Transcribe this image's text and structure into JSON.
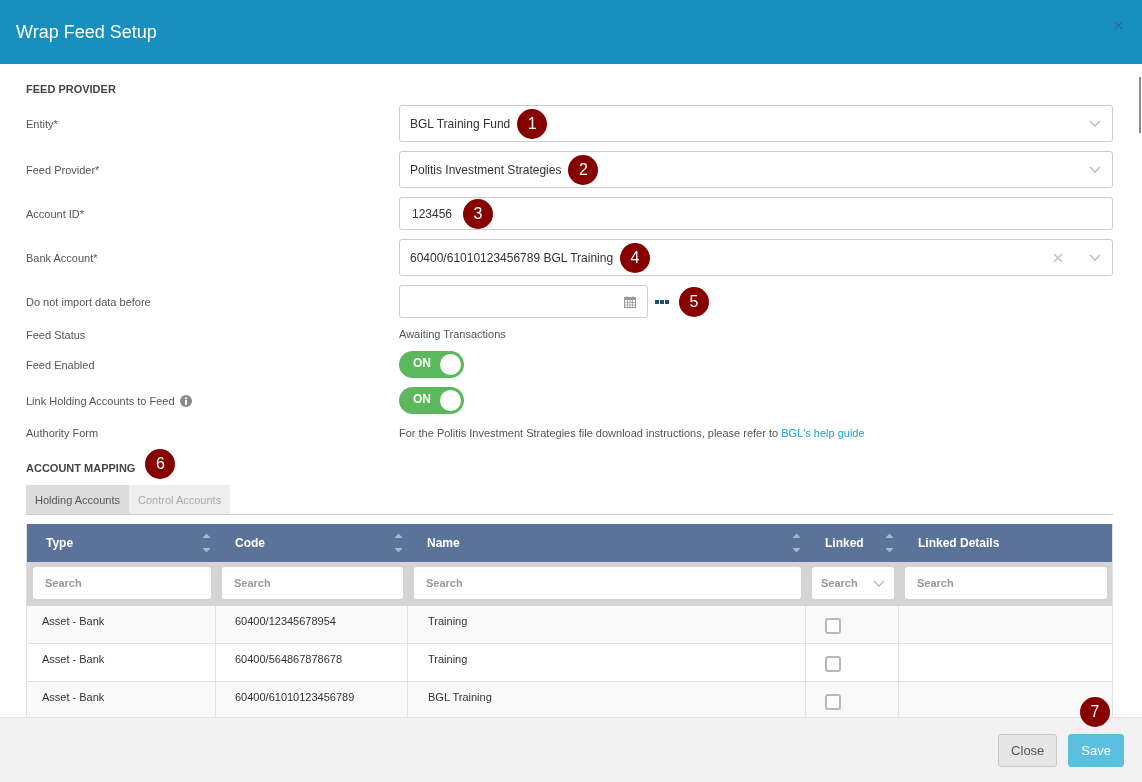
{
  "dialog": {
    "title": "Wrap Feed Setup"
  },
  "feed_provider": {
    "heading": "FEED PROVIDER",
    "fields": [
      {
        "kind": "select",
        "label": "Entity*",
        "value": "BGL Training Fund",
        "marker": "1",
        "clearable": false
      },
      {
        "kind": "select",
        "label": "Feed Provider*",
        "value": "Politis Investment Strategies",
        "marker": "2",
        "clearable": false
      },
      {
        "kind": "text",
        "label": "Account ID*",
        "value": "123456",
        "marker": "3"
      },
      {
        "kind": "select",
        "label": "Bank Account*",
        "value": "60400/61010123456789 BGL Training",
        "marker": "4",
        "clearable": true
      },
      {
        "kind": "date",
        "label": "Do not import data before",
        "marker": "5"
      },
      {
        "kind": "static",
        "label": "Feed Status",
        "value": "Awaiting Transactions"
      },
      {
        "kind": "toggle",
        "label": "Feed Enabled",
        "on": true,
        "state_label": "ON"
      },
      {
        "kind": "toggle",
        "label": "Link Holding Accounts to Feed",
        "info": true,
        "on": true,
        "state_label": "ON"
      },
      {
        "kind": "note",
        "label": "Authority Form",
        "value": "For the Politis Investment Strategies file download instructions, please refer to",
        "link": "BGL's help guide"
      }
    ]
  },
  "account_mapping": {
    "heading": "ACCOUNT MAPPING",
    "marker": "6",
    "tabs": [
      {
        "label": "Holding Accounts",
        "selected": true
      },
      {
        "label": "Control Accounts",
        "selected": false
      }
    ],
    "table": {
      "columns": [
        {
          "label": "Type",
          "sortable": true,
          "filter": {
            "kind": "text",
            "placeholder": "Search"
          }
        },
        {
          "label": "Code",
          "sortable": true,
          "filter": {
            "kind": "text",
            "placeholder": "Search"
          }
        },
        {
          "label": "Name",
          "sortable": true,
          "filter": {
            "kind": "text",
            "placeholder": "Search"
          }
        },
        {
          "label": "Linked",
          "sortable": true,
          "filter": {
            "kind": "select",
            "placeholder": "Search"
          }
        },
        {
          "label": "Linked Details",
          "sortable": false,
          "filter": {
            "kind": "text",
            "placeholder": "Search"
          }
        }
      ],
      "rows": [
        {
          "cells": [
            "Asset - Bank",
            "60400/12345678954",
            "Training"
          ],
          "linked": false
        },
        {
          "cells": [
            "Asset - Bank",
            "60400/564867878678",
            "Training"
          ],
          "linked": false
        },
        {
          "cells": [
            "Asset - Bank",
            "60400/61010123456789",
            "BGL Training"
          ],
          "linked": false
        }
      ]
    }
  },
  "footer": {
    "buttons": [
      {
        "kind": "default",
        "label": "Close"
      },
      {
        "kind": "primary",
        "label": "Save",
        "marker": "7"
      }
    ]
  }
}
